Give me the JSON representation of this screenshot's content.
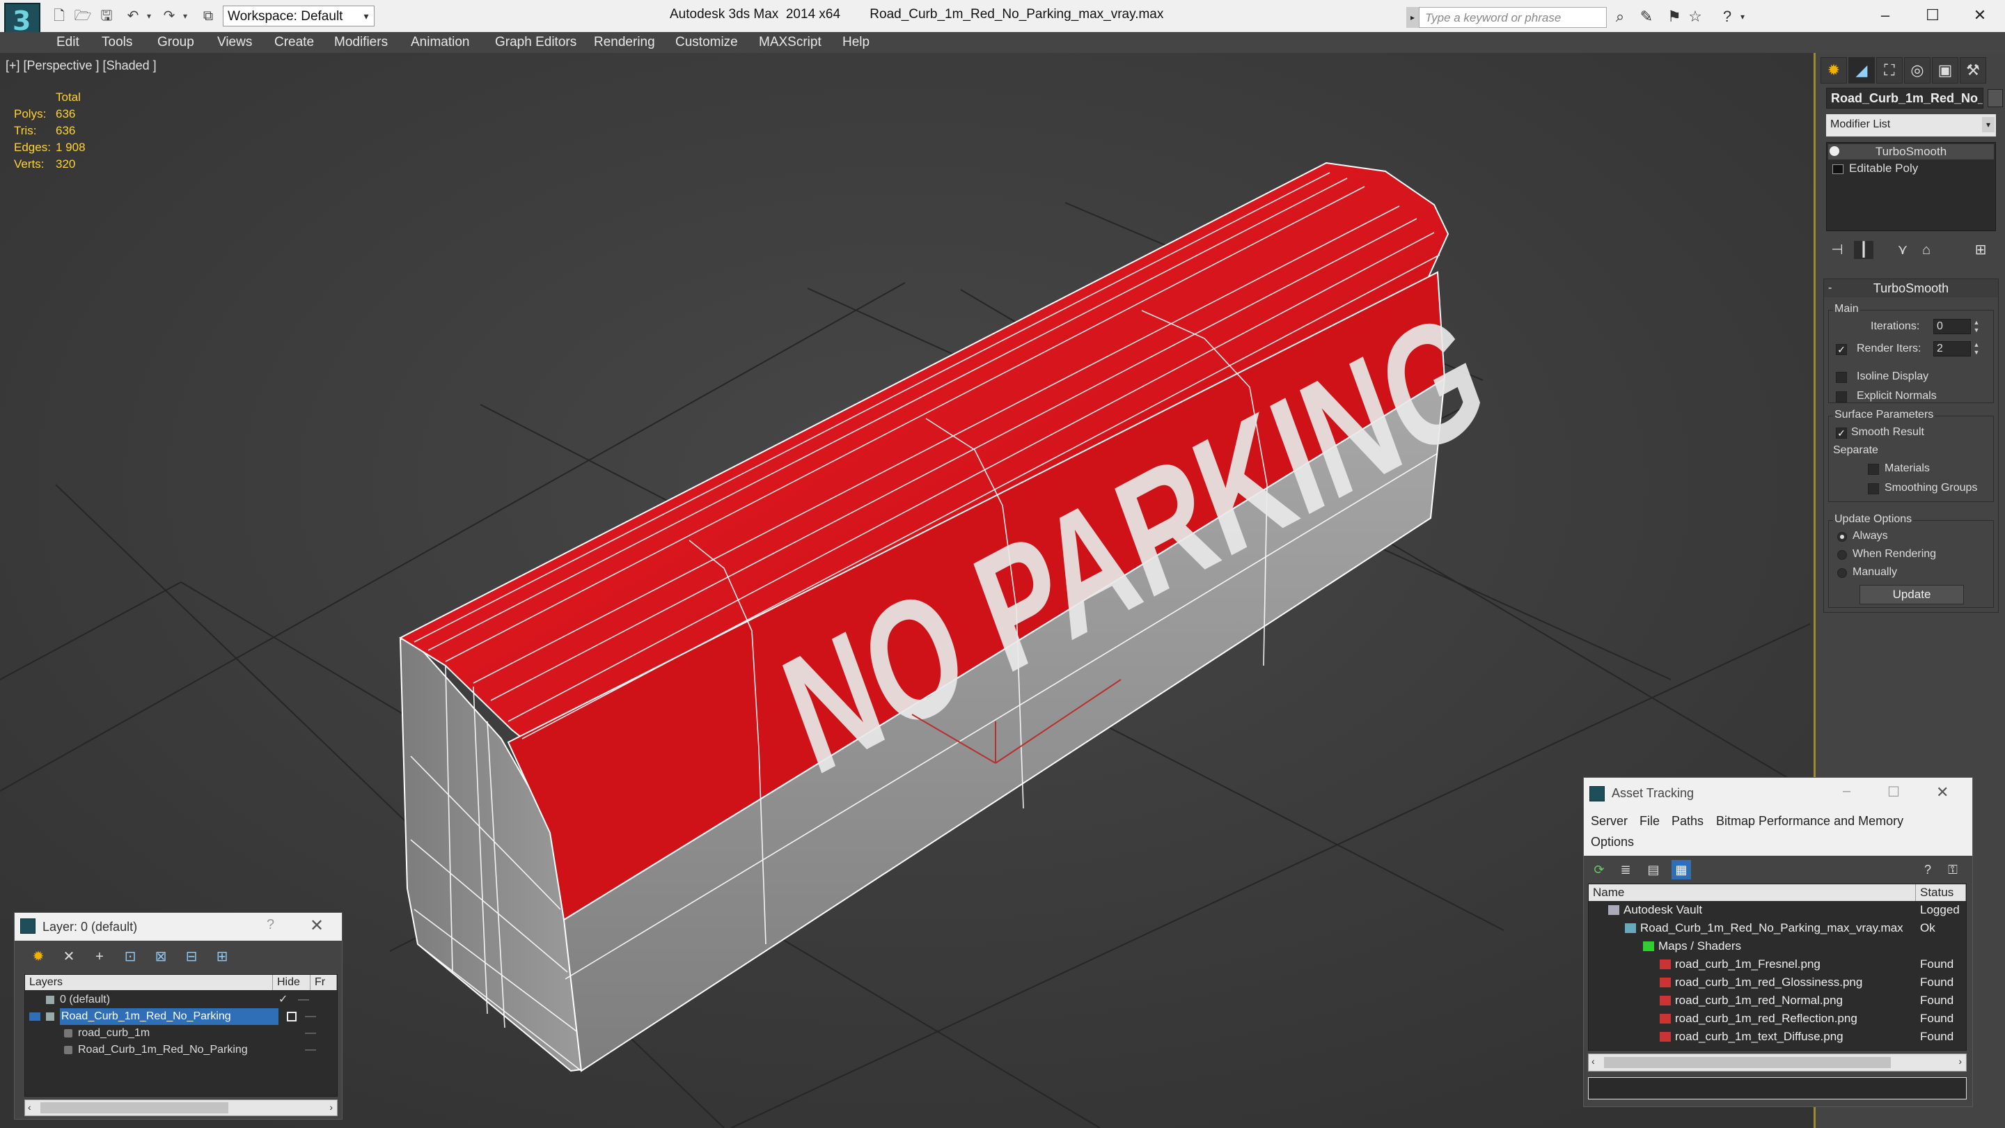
{
  "titlebar": {
    "workspace_label": "Workspace: Default",
    "app_name": "Autodesk 3ds Max  2014 x64",
    "file_name": "Road_Curb_1m_Red_No_Parking_max_vray.max",
    "search_placeholder": "Type a keyword or phrase"
  },
  "menu": [
    "Edit",
    "Tools",
    "Group",
    "Views",
    "Create",
    "Modifiers",
    "Animation",
    "Graph Editors",
    "Rendering",
    "Customize",
    "MAXScript",
    "Help"
  ],
  "viewport": {
    "label": "[+] [Perspective ] [Shaded ]",
    "stats": {
      "header": "Total",
      "rows": [
        {
          "label": "Polys:",
          "value": "636"
        },
        {
          "label": "Tris:",
          "value": "636"
        },
        {
          "label": "Edges:",
          "value": "1 908"
        },
        {
          "label": "Verts:",
          "value": "320"
        }
      ]
    },
    "curb_text": "NO PARKING",
    "colors": {
      "curb_red": "#d6141a",
      "curb_concrete": "#9a9a9a",
      "background": "#3a3a3a",
      "grid": "#1f1f1f",
      "viewport_border": "#9c8a2c"
    }
  },
  "command_panel": {
    "object_name": "Road_Curb_1m_Red_No_",
    "modifier_list": "Modifier List",
    "stack": [
      "TurboSmooth",
      "Editable Poly"
    ],
    "rollout": {
      "title": "TurboSmooth",
      "main_group": "Main",
      "iterations_label": "Iterations:",
      "iterations_value": "0",
      "render_iters_label": "Render Iters:",
      "render_iters_value": "2",
      "render_iters_checked": true,
      "isoline_label": "Isoline Display",
      "isoline_checked": false,
      "explicit_normals_label": "Explicit Normals",
      "explicit_normals_checked": false,
      "surface_group": "Surface Parameters",
      "smooth_result_label": "Smooth Result",
      "smooth_result_checked": true,
      "separate_label": "Separate",
      "materials_label": "Materials",
      "smoothing_groups_label": "Smoothing Groups",
      "update_group": "Update Options",
      "always_label": "Always",
      "when_rendering_label": "When Rendering",
      "manually_label": "Manually",
      "update_options_selected": "Always",
      "update_button": "Update"
    }
  },
  "layer_dialog": {
    "title": "Layer: 0 (default)",
    "help": "?",
    "columns": [
      "Layers",
      "Hide",
      "Fr"
    ],
    "rows": [
      {
        "name": "0 (default)",
        "indent": 1,
        "selected": false
      },
      {
        "name": "Road_Curb_1m_Red_No_Parking",
        "indent": 1,
        "selected": true
      },
      {
        "name": "road_curb_1m",
        "indent": 2,
        "selected": false
      },
      {
        "name": "Road_Curb_1m_Red_No_Parking",
        "indent": 2,
        "selected": false
      }
    ]
  },
  "asset_dialog": {
    "title": "Asset Tracking",
    "menu": [
      "Server",
      "File",
      "Paths",
      "Bitmap Performance and Memory",
      "Options"
    ],
    "columns": [
      "Name",
      "Status"
    ],
    "rows": [
      {
        "name": "Autodesk Vault",
        "status": "Logged",
        "indent": 1
      },
      {
        "name": "Road_Curb_1m_Red_No_Parking_max_vray.max",
        "status": "Ok",
        "indent": 2
      },
      {
        "name": "Maps / Shaders",
        "status": "",
        "indent": 3
      },
      {
        "name": "road_curb_1m_Fresnel.png",
        "status": "Found",
        "indent": 4
      },
      {
        "name": "road_curb_1m_red_Glossiness.png",
        "status": "Found",
        "indent": 4
      },
      {
        "name": "road_curb_1m_red_Normal.png",
        "status": "Found",
        "indent": 4
      },
      {
        "name": "road_curb_1m_red_Reflection.png",
        "status": "Found",
        "indent": 4
      },
      {
        "name": "road_curb_1m_text_Diffuse.png",
        "status": "Found",
        "indent": 4
      }
    ]
  }
}
